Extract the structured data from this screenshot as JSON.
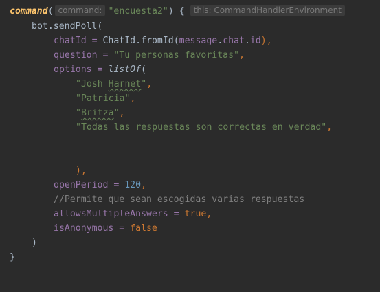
{
  "code": {
    "l1": {
      "fn_name": "command",
      "open_paren": "(",
      "param_hint": "command:",
      "arg": "\"encuesta2\"",
      "close_paren_brace": ") {",
      "receiver_hint": "this: CommandHandlerEnvironment"
    },
    "l2": {
      "receiver": "bot",
      "dot": ".",
      "method": "sendPoll",
      "open": "("
    },
    "l3": {
      "name": "chatId",
      "eq": " = ",
      "cls": "ChatId",
      "dot": ".",
      "method": "fromId",
      "open": "(",
      "arg": "message.chat.id",
      "close": "),",
      "arg_parts": [
        "message",
        ".",
        "chat",
        ".",
        "id"
      ]
    },
    "l4": {
      "name": "question",
      "eq": " = ",
      "value": "\"Tu personas favoritas\"",
      "comma": ","
    },
    "l5": {
      "name": "options",
      "eq": " = ",
      "fn": "listOf",
      "open": "("
    },
    "l6": {
      "q1": "\"Josh ",
      "typo": "Harnet",
      "q2": "\"",
      "comma": ","
    },
    "l7": {
      "value": "\"Patricia\"",
      "comma": ","
    },
    "l8": {
      "q1": "\"",
      "typo": "Britza",
      "q2": "\"",
      "comma": ","
    },
    "l9": {
      "value": "\"Todas las respuestas son correctas en verdad\"",
      "comma": ","
    },
    "l12": {
      "value": "),"
    },
    "l13": {
      "name": "openPeriod",
      "eq": " = ",
      "value": "120",
      "comma": ","
    },
    "l14": {
      "value": "//Permite que sean escogidas varias respuestas"
    },
    "l15": {
      "name": "allowsMultipleAnswers",
      "eq": " = ",
      "value": "true",
      "comma": ","
    },
    "l16": {
      "name": "isAnonymous",
      "eq": " = ",
      "value": "false"
    },
    "l17": {
      "value": ")"
    },
    "l18": {
      "value": "}"
    }
  },
  "colors": {
    "background": "#2b2b2b",
    "default": "#a9b7c6",
    "keyword": "#cc7832",
    "function": "#ffc66d",
    "string": "#6a8759",
    "number": "#6897bb",
    "named_arg": "#9876aa",
    "comment": "#808080"
  }
}
